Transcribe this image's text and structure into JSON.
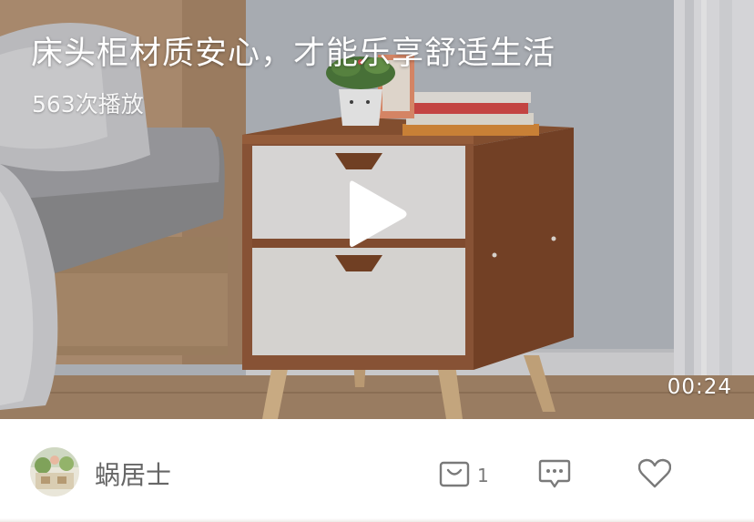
{
  "video": {
    "title": "床头柜材质安心，才能乐享舒适生活",
    "play_count": "563次播放",
    "duration": "00:24",
    "play_icon": "play-icon"
  },
  "footer": {
    "author_name": "蜗居士",
    "avatar_icon": "avatar",
    "cart": {
      "icon": "shopping-bag-icon",
      "count": "1"
    },
    "comment": {
      "icon": "comment-icon"
    },
    "like": {
      "icon": "heart-icon"
    }
  },
  "colors": {
    "icon_gray": "#7a7a7a",
    "title_text": "#ffffff"
  }
}
